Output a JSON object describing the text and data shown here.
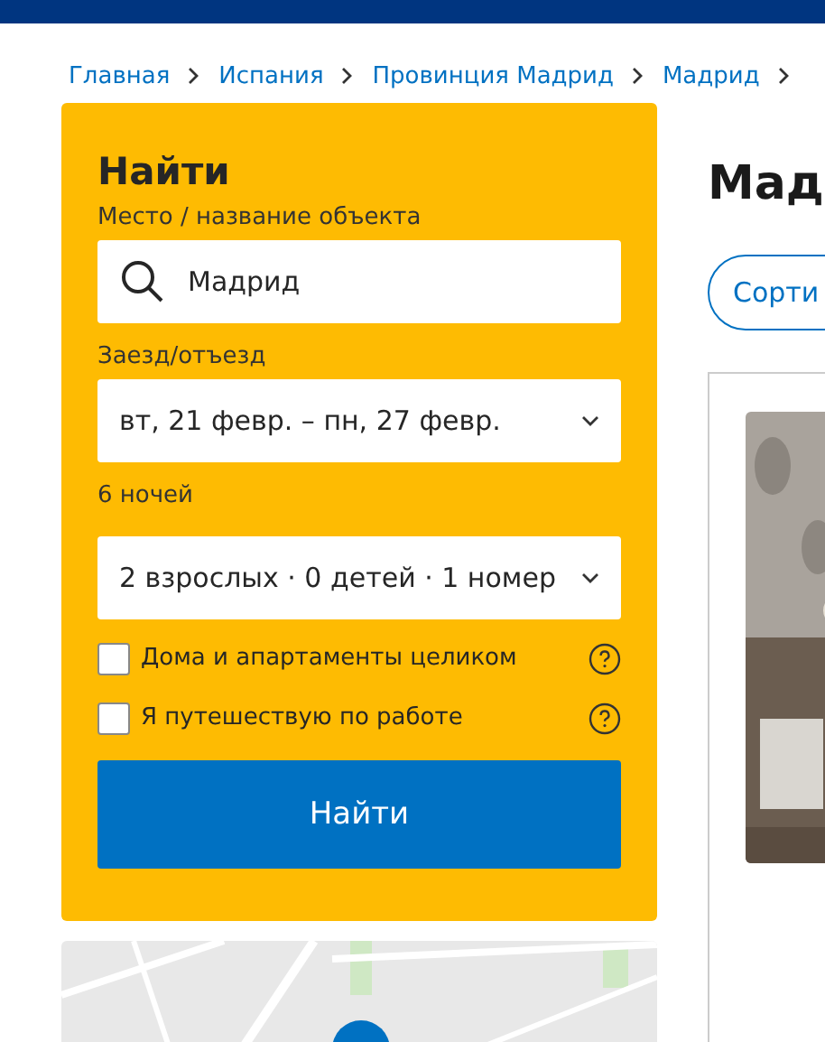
{
  "breadcrumbs": [
    "Главная",
    "Испания",
    "Провинция Мадрид",
    "Мадрид"
  ],
  "search_panel": {
    "title": "Найти",
    "destination": {
      "label": "Место / название объекта",
      "value": "Мадрид"
    },
    "dates": {
      "label": "Заезд/отъезд",
      "value": "вт, 21 февр. – пн, 27 февр."
    },
    "nights": "6 ночей",
    "guests": {
      "value": "2 взрослых · 0 детей · 1 номер"
    },
    "options": [
      {
        "label": "Дома и апартаменты целиком",
        "checked": false
      },
      {
        "label": "Я путешествую по работе",
        "checked": false
      }
    ],
    "button": "Найти"
  },
  "results": {
    "heading": "Мад",
    "sort_button": "Сорти"
  }
}
